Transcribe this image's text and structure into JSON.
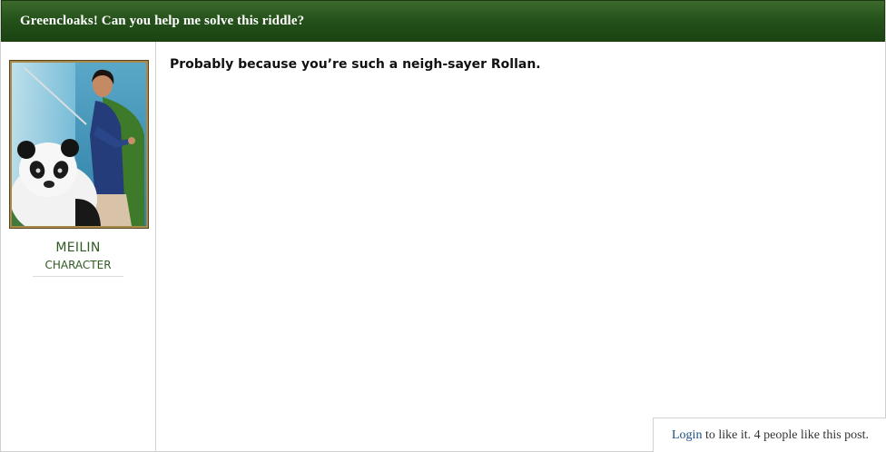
{
  "header": {
    "title": "Greencloaks! Can you help me solve this riddle?"
  },
  "author": {
    "name": "MEILIN",
    "role": "CHARACTER",
    "avatar_icon": "meilin-panda-portrait"
  },
  "post": {
    "text": "Probably because you’re such a neigh-sayer Rollan."
  },
  "likes": {
    "login_label": "Login",
    "suffix_text": " to like it. 4 people like this post."
  },
  "colors": {
    "header_green": "#24501a",
    "name_green": "#2f5a24",
    "link_blue": "#1b4f86"
  }
}
